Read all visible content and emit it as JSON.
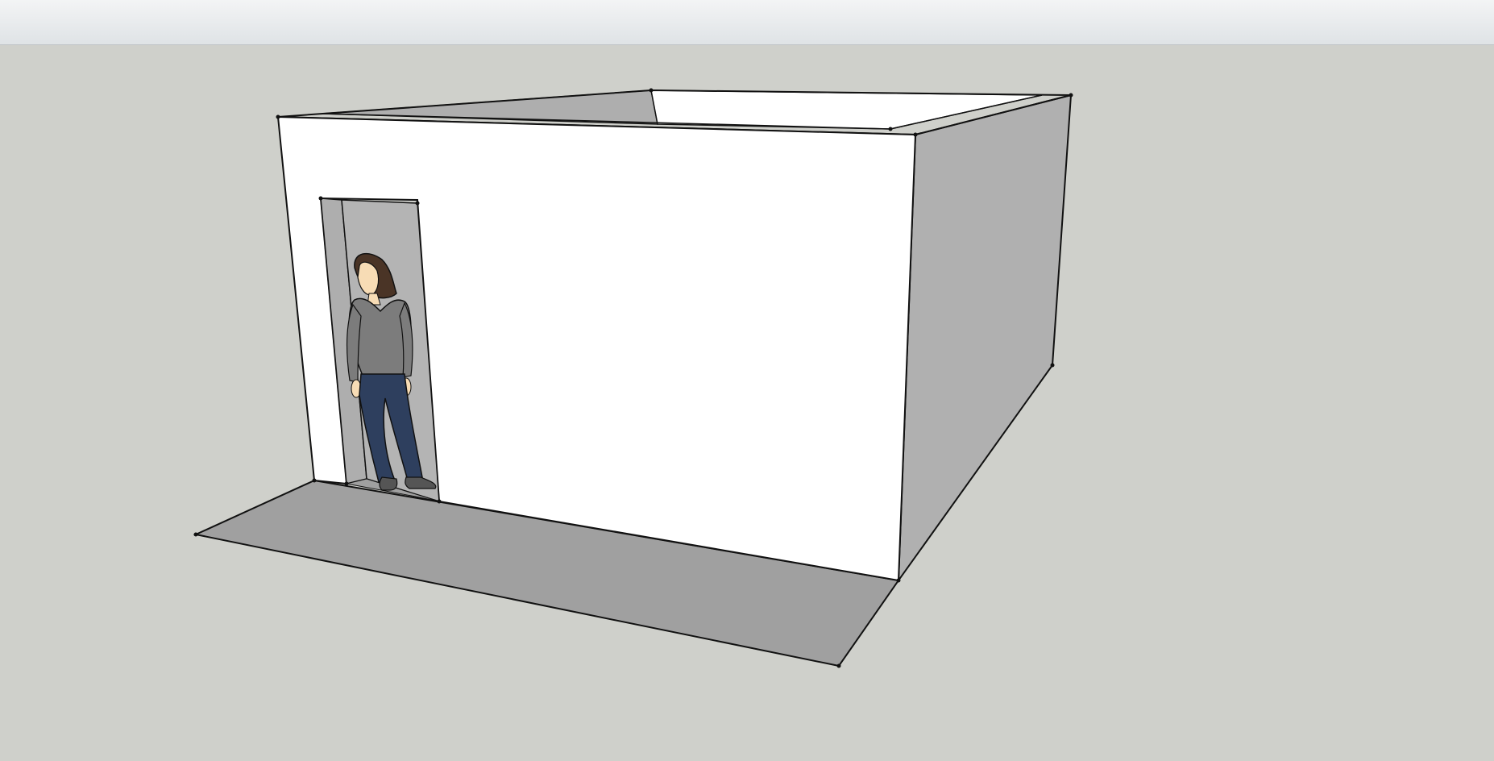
{
  "app": {
    "kind": "3d-modeling-viewport"
  },
  "scene": {
    "background_color": "#cfd0cb",
    "wall_color": "#ffffff",
    "wall_shadow_color": "#b0b0b0",
    "floor_color": "#a0a0a0",
    "edge_color": "#111111",
    "figure": {
      "hair_color": "#4a3426",
      "skin_color": "#f7dcb5",
      "shirt_color": "#7c7c7c",
      "pants_color": "#2e3f5e",
      "shoe_color": "#555555"
    }
  }
}
